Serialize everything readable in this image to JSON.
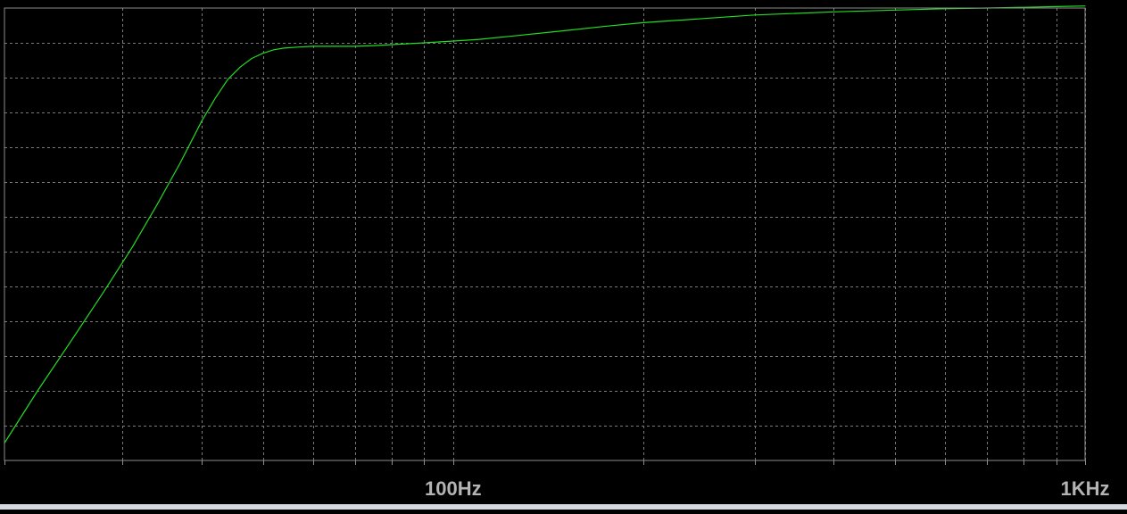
{
  "window": {
    "background": "#000000"
  },
  "chart_data": {
    "type": "line",
    "title": "",
    "xlabel": "",
    "ylabel": "",
    "x_scale": "log",
    "xlim": [
      19.5,
      1000
    ],
    "ylim": [
      0,
      13
    ],
    "grid": true,
    "x_ticks": [
      {
        "value": 100,
        "label": "100Hz"
      },
      {
        "value": 1000,
        "label": "1KHz"
      }
    ],
    "x_minor_ticks": [
      30,
      40,
      50,
      60,
      70,
      80,
      90,
      200,
      300,
      400,
      500,
      600,
      700,
      800,
      900
    ],
    "y_gridlines": [
      1,
      2,
      3,
      4,
      5,
      6,
      7,
      8,
      9,
      10,
      11,
      12
    ],
    "series": [
      {
        "name": "",
        "color": "#22dd22",
        "x": [
          19.5,
          22,
          25,
          28,
          31,
          34,
          37,
          40,
          42,
          44,
          46,
          48,
          50,
          52,
          54,
          57,
          60,
          65,
          70,
          75,
          80,
          90,
          100,
          110,
          125,
          150,
          175,
          200,
          250,
          300,
          400,
          500,
          600,
          700,
          800,
          900,
          1000
        ],
        "y": [
          0.5,
          2.0,
          3.5,
          4.85,
          6.1,
          7.35,
          8.55,
          9.75,
          10.4,
          10.95,
          11.3,
          11.55,
          11.7,
          11.8,
          11.85,
          11.88,
          11.9,
          11.9,
          11.9,
          11.92,
          11.95,
          12.0,
          12.05,
          12.1,
          12.2,
          12.35,
          12.48,
          12.58,
          12.7,
          12.8,
          12.89,
          12.94,
          12.98,
          13.0,
          13.02,
          13.04,
          13.06
        ]
      }
    ]
  }
}
